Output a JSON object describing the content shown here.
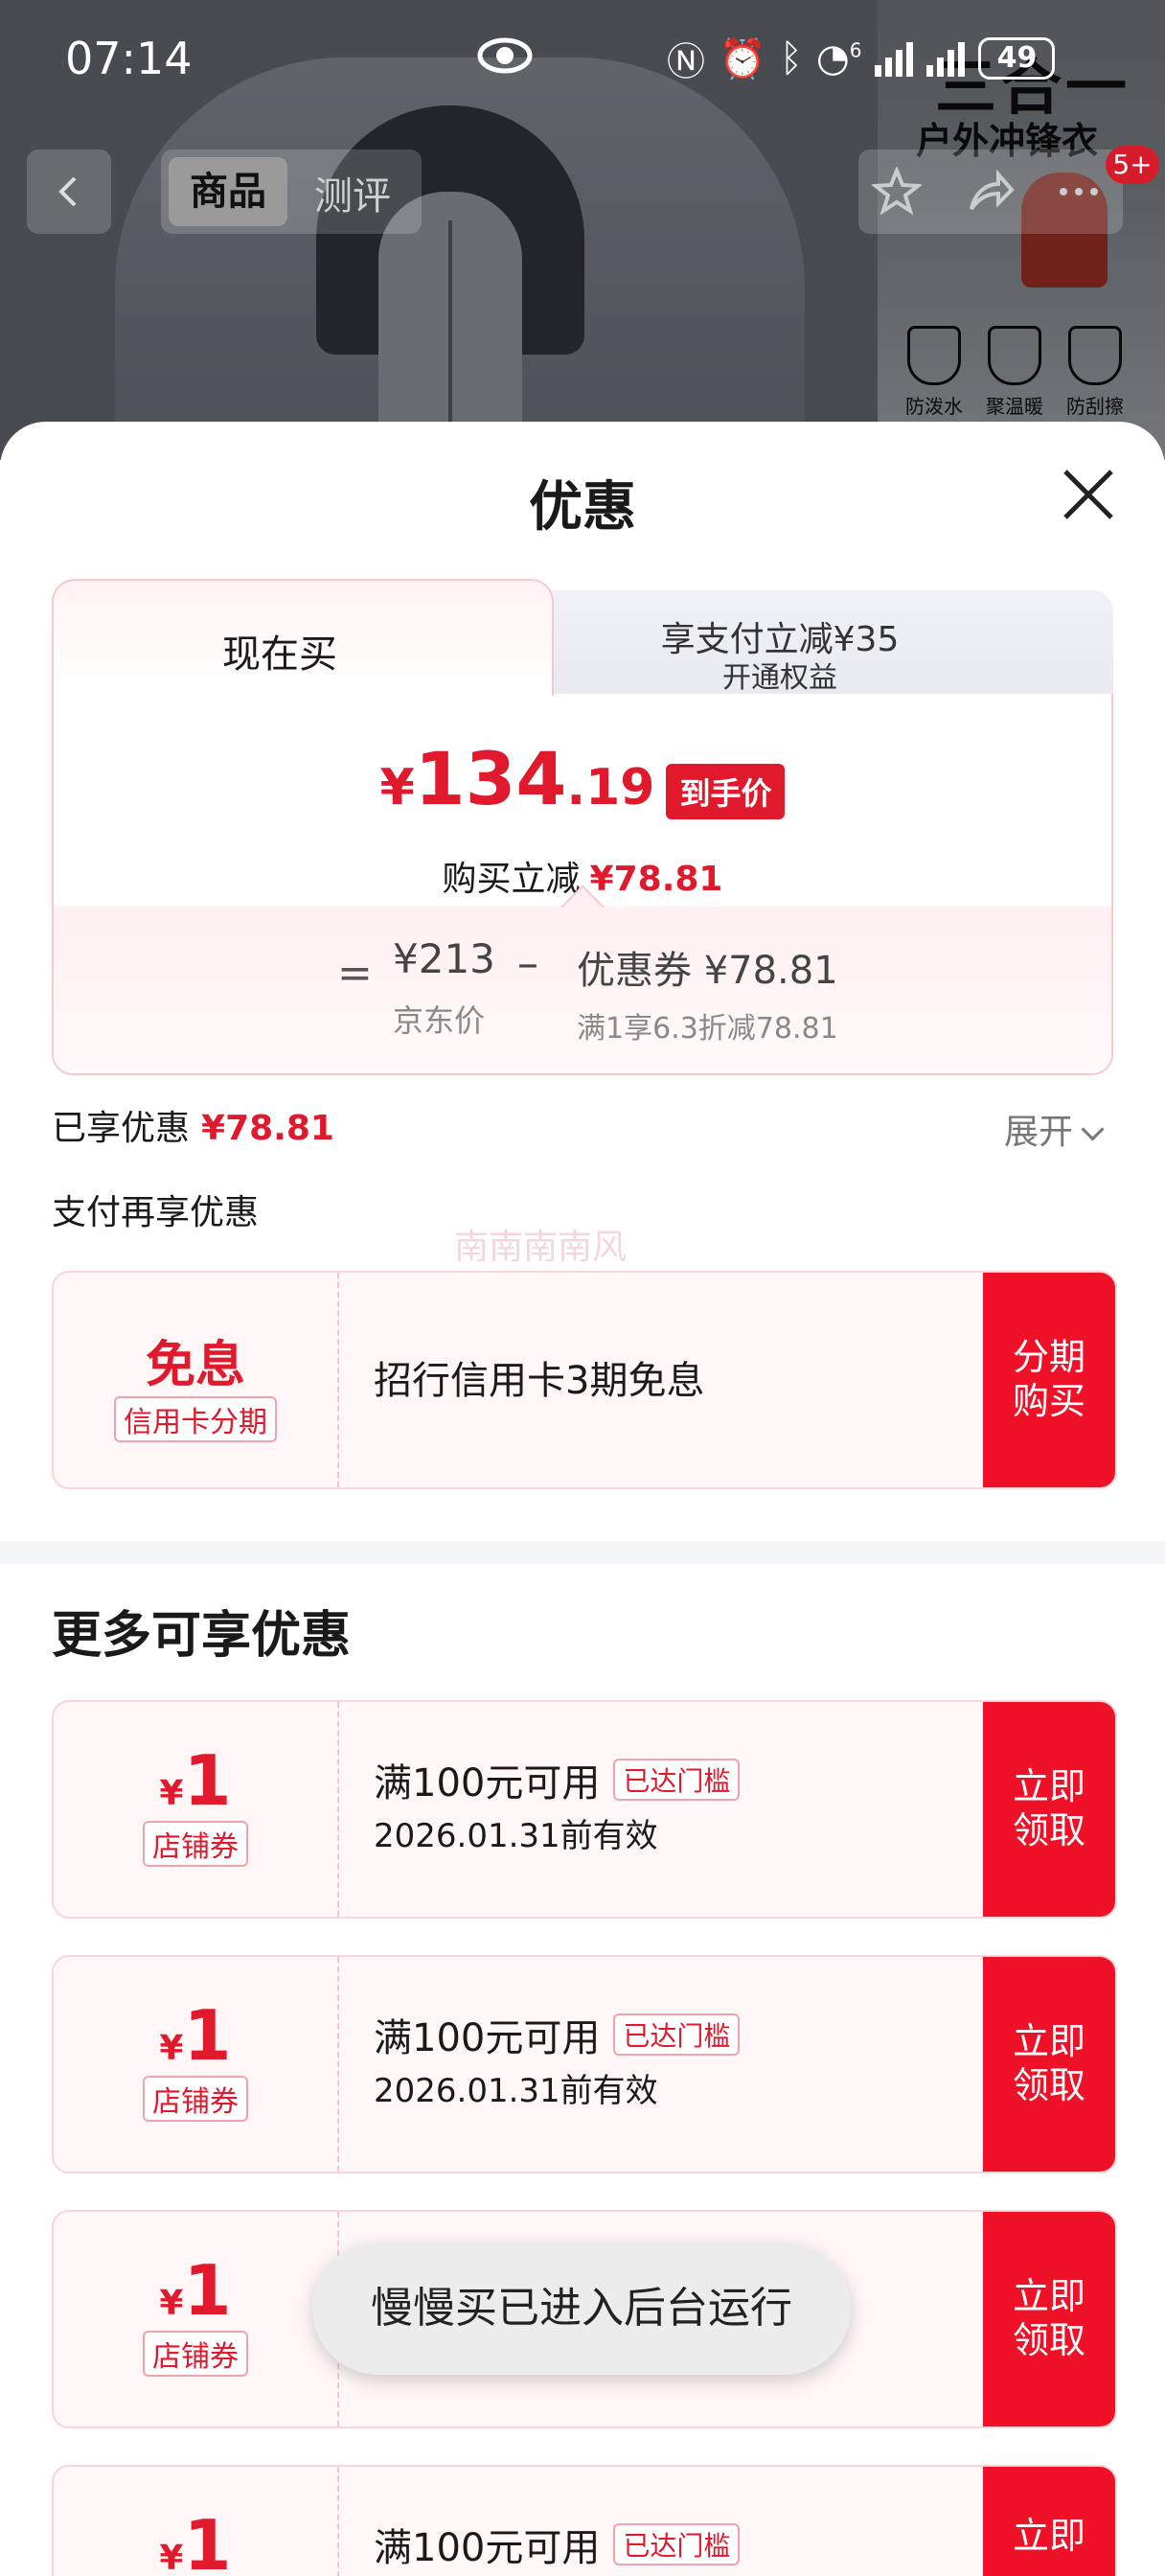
{
  "status_bar": {
    "time": "07:14",
    "network": "6",
    "battery": "49"
  },
  "nav": {
    "tab_goods": "商品",
    "tab_review": "测评",
    "cart_badge": "5+"
  },
  "background": {
    "banner_title": "三合一",
    "banner_subtitle": "户外冲锋衣",
    "features": [
      {
        "en": "Waterproof",
        "zh": "防泼水"
      },
      {
        "en": "Keep warm",
        "zh": "聚温暖"
      },
      {
        "en": "Wear-resistant",
        "zh": "防刮擦"
      }
    ]
  },
  "sheet": {
    "title": "优惠",
    "tab_now": "现在买",
    "tab_pay_line1": "享支付立减¥35",
    "tab_pay_line2": "开通权益",
    "price_symbol": "¥",
    "price_int": "134",
    "price_dec": ".19",
    "final_price_tag": "到手价",
    "reduce_label": "购买立减",
    "reduce_value": "¥78.81",
    "eq": "=",
    "jd_price": "¥213",
    "jd_label": "京东价",
    "minus": "–",
    "coupon_label": "优惠券 ¥78.81",
    "coupon_detail": "满1享6.3折减78.81",
    "enjoyed_label": "已享优惠",
    "enjoyed_value": "¥78.81",
    "expand": "展开",
    "pay_again": "支付再享优惠",
    "watermark": "南南南南风"
  },
  "credit": {
    "title": "免息",
    "sub": "信用卡分期",
    "desc": "招行信用卡3期免息",
    "button": "分期\n购买"
  },
  "more": {
    "title": "更多可享优惠",
    "coupons": [
      {
        "yen": "¥",
        "amount": "1",
        "type": "店铺券",
        "condition": "满100元可用",
        "tag": "已达门槛",
        "valid": "2026.01.31前有效",
        "button": "立即\n领取"
      },
      {
        "yen": "¥",
        "amount": "1",
        "type": "店铺券",
        "condition": "满100元可用",
        "tag": "已达门槛",
        "valid": "2026.01.31前有效",
        "button": "立即\n领取"
      },
      {
        "yen": "¥",
        "amount": "1",
        "type": "店铺券",
        "condition": "",
        "tag": "",
        "valid": "",
        "button": "立即\n领取"
      },
      {
        "yen": "¥",
        "amount": "1",
        "type": "",
        "condition": "满100元可用",
        "tag": "已达门槛",
        "valid": "",
        "button": "立即"
      }
    ]
  },
  "toast": "慢慢买已进入后台运行",
  "colors": {
    "accent": "#e0192d",
    "button_red": "#ee1128",
    "coupon_bg": "#fff6f7"
  }
}
